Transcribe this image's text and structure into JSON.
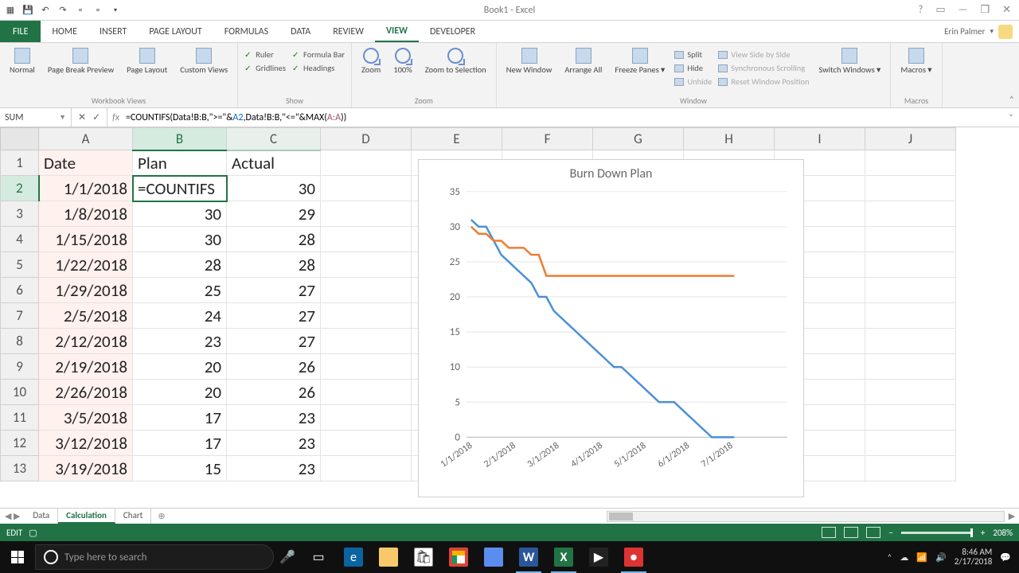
{
  "titlebar": {
    "title": "Book1 - Excel",
    "user_name": "Erin Palmer"
  },
  "tabs": {
    "file": "FILE",
    "items": [
      "HOME",
      "INSERT",
      "PAGE LAYOUT",
      "FORMULAS",
      "DATA",
      "REVIEW",
      "VIEW",
      "DEVELOPER"
    ],
    "active_index": 6
  },
  "ribbon": {
    "workbook_views": {
      "label": "Workbook Views",
      "normal": "Normal",
      "pagebreak": "Page Break\nPreview",
      "pagelayout": "Page\nLayout",
      "custom": "Custom\nViews"
    },
    "show": {
      "label": "Show",
      "ruler": "Ruler",
      "formulabar": "Formula Bar",
      "gridlines": "Gridlines",
      "headings": "Headings"
    },
    "zoom": {
      "label": "Zoom",
      "zoom": "Zoom",
      "p100": "100%",
      "tosel": "Zoom to\nSelection"
    },
    "window": {
      "label": "Window",
      "new": "New\nWindow",
      "arrange": "Arrange\nAll",
      "freeze": "Freeze\nPanes ▾",
      "split": "Split",
      "hide": "Hide",
      "unhide": "Unhide",
      "sidebyside": "View Side by Side",
      "sync": "Synchronous Scrolling",
      "reset": "Reset Window Position",
      "switch": "Switch\nWindows ▾"
    },
    "macros": {
      "label": "Macros",
      "btn": "Macros\n▾"
    }
  },
  "namebox": "SUM",
  "formula_bar": {
    "prefix": "=COUNTIFS(Data!B:B,\">=\"&",
    "a2": "A2",
    "mid": ",Data!B:B,\"<=\"&MAX(",
    "aa": "A:A",
    "suffix": "))"
  },
  "columns": [
    "A",
    "B",
    "C",
    "D",
    "E",
    "F",
    "G",
    "H",
    "I",
    "J"
  ],
  "headers": {
    "A": "Date",
    "B": "Plan",
    "C": "Actual"
  },
  "active_cell_display": "=COUNTIFS",
  "rows": [
    {
      "r": 2,
      "date": "1/1/2018",
      "plan_display": "=COUNTIFS",
      "actual": 30
    },
    {
      "r": 3,
      "date": "1/8/2018",
      "plan": 30,
      "actual": 29
    },
    {
      "r": 4,
      "date": "1/15/2018",
      "plan": 30,
      "actual": 28
    },
    {
      "r": 5,
      "date": "1/22/2018",
      "plan": 28,
      "actual": 28
    },
    {
      "r": 6,
      "date": "1/29/2018",
      "plan": 25,
      "actual": 27
    },
    {
      "r": 7,
      "date": "2/5/2018",
      "plan": 24,
      "actual": 27
    },
    {
      "r": 8,
      "date": "2/12/2018",
      "plan": 23,
      "actual": 27
    },
    {
      "r": 9,
      "date": "2/19/2018",
      "plan": 20,
      "actual": 26
    },
    {
      "r": 10,
      "date": "2/26/2018",
      "plan": 20,
      "actual": 26
    },
    {
      "r": 11,
      "date": "3/5/2018",
      "plan": 17,
      "actual": 23
    },
    {
      "r": 12,
      "date": "3/12/2018",
      "plan": 17,
      "actual": 23
    },
    {
      "r": 13,
      "date": "3/19/2018",
      "plan": 15,
      "actual": 23
    }
  ],
  "sheet_tabs": {
    "items": [
      "Data",
      "Calculation",
      "Chart"
    ],
    "active_index": 1
  },
  "statusbar": {
    "mode": "EDIT",
    "zoom": "208%"
  },
  "taskbar": {
    "search_placeholder": "Type here to search",
    "time": "8:46 AM",
    "date": "2/17/2018"
  },
  "chart_data": {
    "type": "line",
    "title": "Burn Down Plan",
    "xlabel": "",
    "ylabel": "",
    "ylim": [
      0,
      35
    ],
    "categories": [
      "1/1/2018",
      "2/1/2018",
      "3/1/2018",
      "4/1/2018",
      "5/1/2018",
      "6/1/2018",
      "7/1/2018"
    ],
    "series": [
      {
        "name": "Plan",
        "color": "#4a90d9",
        "values": [
          31,
          30,
          30,
          28,
          26,
          25,
          24,
          23,
          22,
          20,
          20,
          18,
          17,
          16,
          15,
          14,
          13,
          12,
          11,
          10,
          10,
          9,
          8,
          7,
          6,
          5,
          5,
          5,
          4,
          3,
          2,
          1,
          0,
          0,
          0,
          0
        ]
      },
      {
        "name": "Actual",
        "color": "#ed7d31",
        "values": [
          30,
          29,
          29,
          28,
          28,
          27,
          27,
          27,
          26,
          26,
          23,
          23,
          23,
          23,
          23,
          23,
          23,
          23,
          23,
          23,
          23,
          23,
          23,
          23,
          23,
          23,
          23,
          23,
          23,
          23,
          23,
          23,
          23,
          23,
          23,
          23
        ]
      }
    ]
  }
}
